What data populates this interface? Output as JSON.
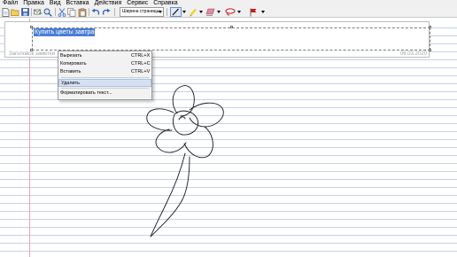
{
  "menu": {
    "items": [
      {
        "label": "Файл"
      },
      {
        "label": "Правка"
      },
      {
        "label": "Вид"
      },
      {
        "label": "Вставка"
      },
      {
        "label": "Действия"
      },
      {
        "label": "Сервис"
      },
      {
        "label": "Справка"
      }
    ]
  },
  "toolbar": {
    "zoom_value": "Ширина страницы",
    "icons": [
      "new-note-icon",
      "open-icon",
      "save-icon",
      "send-icon",
      "find-icon",
      "cut-icon",
      "copy-icon",
      "paste-icon",
      "undo-icon",
      "redo-icon",
      "pen-icon",
      "highlighter-icon",
      "eraser-icon",
      "lasso-icon",
      "flag-icon"
    ],
    "colors": {
      "accent": "#1f57b8",
      "pen": "#000000",
      "highlighter": "#f2d31b",
      "eraser": "#e58aa2",
      "lasso": "#c0181f",
      "flag": "#d21919"
    }
  },
  "note": {
    "title": "Купить цветы завтра",
    "title_hint": "Заголовок заметки",
    "date": "06.03.2020"
  },
  "context_menu": {
    "items": [
      {
        "label": "Вырезать",
        "shortcut": "CTRL+X"
      },
      {
        "label": "Копировать",
        "shortcut": "CTRL+C"
      },
      {
        "label": "Вставить",
        "shortcut": "CTRL+V"
      },
      {
        "label": "Удалить",
        "shortcut": ""
      },
      {
        "label": "Форматировать текст...",
        "shortcut": ""
      }
    ],
    "highlighted_index": 3
  },
  "canvas": {
    "line_color": "#c6d2e6",
    "margin_color": "#e4a3a3",
    "drawing": "flower-sketch"
  }
}
